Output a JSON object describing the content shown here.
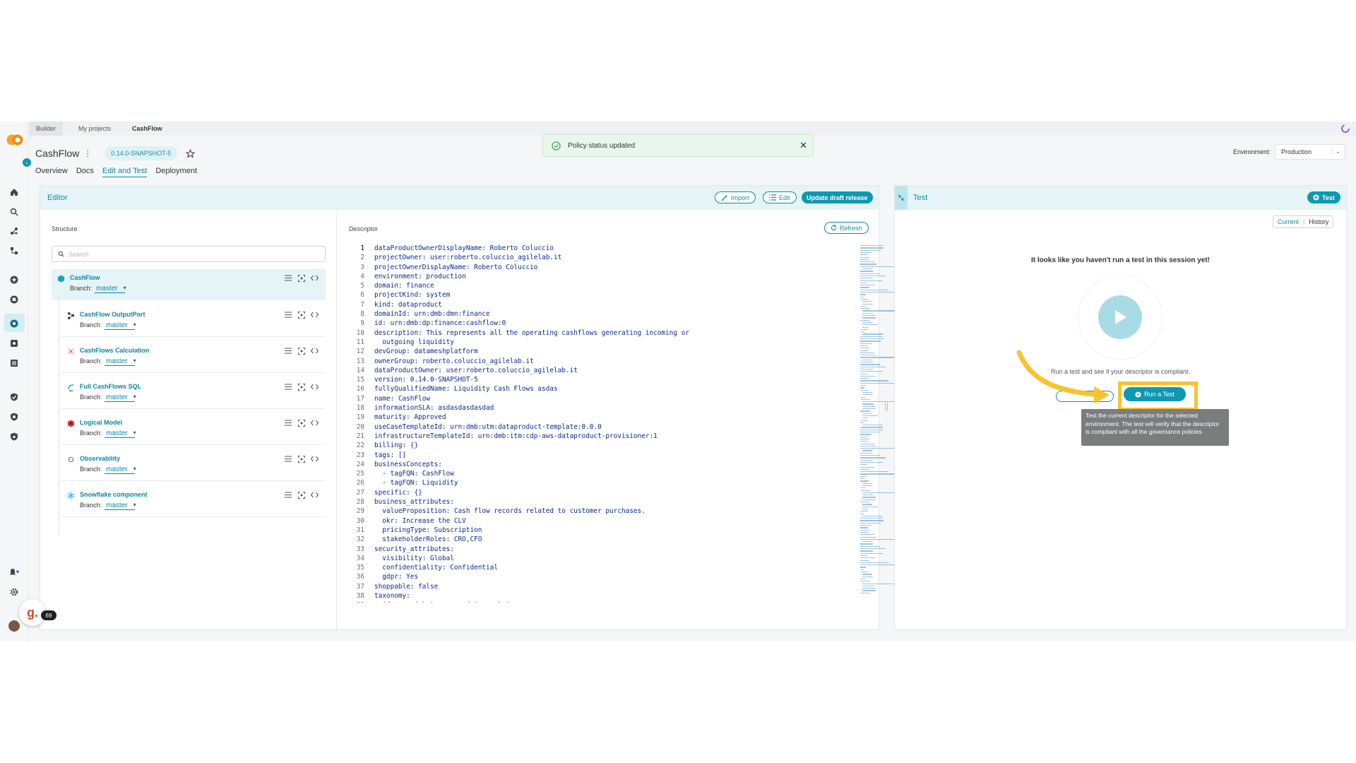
{
  "breadcrumb": [
    "Builder",
    "My projects",
    "CashFlow"
  ],
  "project": {
    "title": "CashFlow",
    "version": "0.14.0-SNAPSHOT-5"
  },
  "nav_tabs": [
    "Overview",
    "Docs",
    "Edit and Test",
    "Deployment"
  ],
  "active_tab": "Edit and Test",
  "toast": {
    "message": "Policy status updated"
  },
  "environment": {
    "label": "Environment:",
    "value": "Production"
  },
  "editor": {
    "title": "Editor",
    "import_label": "Import",
    "edit_label": "Edit",
    "update_label": "Update draft release",
    "structure_label": "Structure",
    "search_placeholder": "Search",
    "descriptor_label": "Descriptor",
    "refresh_label": "Refresh",
    "branch_label": "Branch:",
    "components": [
      {
        "name": "CashFlow",
        "branch": "master",
        "icon": "cashflow-hexagon-icon"
      },
      {
        "name": "CashFlow OutputPort",
        "branch": "master",
        "icon": "output-port-icon"
      },
      {
        "name": "CashFlows Calculation",
        "branch": "master",
        "icon": "spark-icon"
      },
      {
        "name": "Full CashFlows SQL",
        "branch": "master",
        "icon": "trino-icon"
      },
      {
        "name": "Logical Model",
        "branch": "master",
        "icon": "logical-model-icon"
      },
      {
        "name": "Observability",
        "branch": "master",
        "icon": "observability-icon"
      },
      {
        "name": "Snowflake component",
        "branch": "master",
        "icon": "snowflake-icon"
      }
    ],
    "code_lines": [
      "dataProductOwnerDisplayName: Roberto Coluccio",
      "projectOwner: user:roberto.coluccio_agilelab.it",
      "projectOwnerDisplayName: Roberto Coluccio",
      "environment: production",
      "domain: finance",
      "projectKind: system",
      "kind: dataproduct",
      "domainId: urn:dmb:dmn:finance",
      "id: urn:dmb:dp:finance:cashflow:0",
      "description: This represents all the operating cashflows generating incoming or",
      "  outgoing liquidity",
      "devGroup: datameshplatform",
      "ownerGroup: roberto.coluccio_agilelab.it",
      "dataProductOwner: user:roberto.coluccio_agilelab.it",
      "version: 0.14.0-SNAPSHOT-5",
      "fullyQualifiedName: Liquidity Cash Flows asdas",
      "name: CashFlow",
      "informationSLA: asdasdasdasdad",
      "maturity: Approved",
      "useCaseTemplateId: urn:dmb:utm:dataproduct-template:0.0.0",
      "infrastructureTemplateId: urn:dmb:itm:cdp-aws-dataproduct-provisioner:1",
      "billing: {}",
      "tags: []",
      "businessConcepts:",
      "  - tagFQN: CashFlow",
      "  - tagFQN: Liquidity",
      "specific: {}",
      "business_attributes:",
      "  valueProposition: Cash flow records related to customer purchases.",
      "  okr: Increase the CLV",
      "  pricingType: Subscription",
      "  stakeholderRoles: CRO,CFO",
      "security_attributes:",
      "  visibility: Global",
      "  confidentiality: Confidential",
      "  gdpr: Yes",
      "shoppable: false",
      "taxonomy:",
      "  id: urn:dmb:taxonomy:data-mesh-taxonomy"
    ]
  },
  "test": {
    "title": "Test",
    "test_button_label": "Test",
    "tab_current": "Current",
    "tab_history": "History",
    "empty_title": "It looks like you haven't run a test in this session yet!",
    "empty_subtitle": "Run a test and see if your descriptor is compliant.",
    "run_button_label": "Run a Test",
    "tooltip": "Test the current descriptor for the selected environment. The test will verify that the descriptor is compliant with all the governance policies"
  },
  "chat_badge": {
    "count": "69"
  },
  "colors": {
    "accent": "#0f98b1",
    "highlight": "#f7c331",
    "toast_bg": "#e8f6ec"
  }
}
